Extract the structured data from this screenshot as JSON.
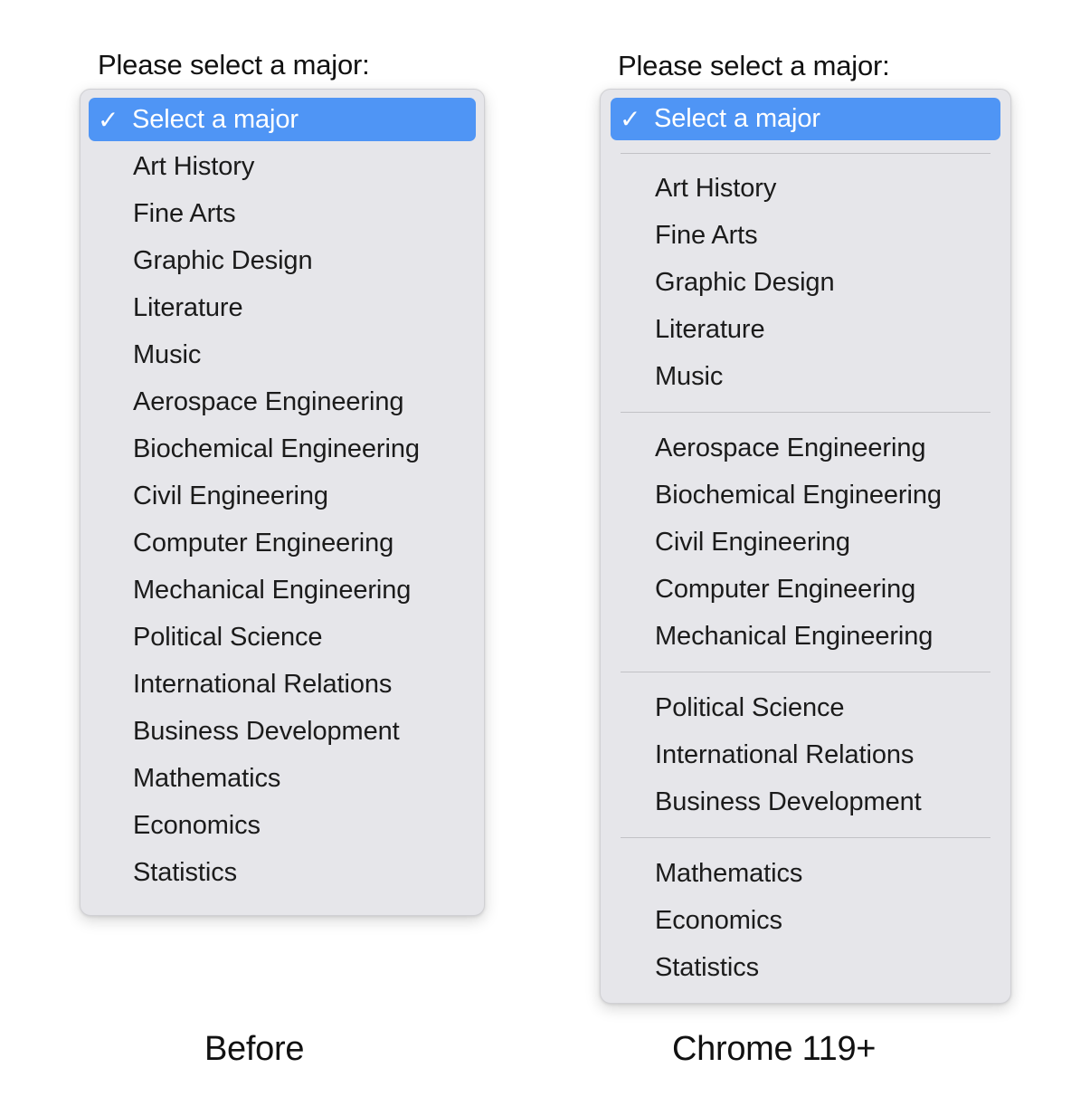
{
  "page": {
    "background_color": "#ffffff"
  },
  "colors": {
    "accent_blue": "#4f95f5",
    "panel_background": "#e6e6ea",
    "panel_border": "#d0d0d4",
    "separator": "#c2c2c6",
    "text": "#1b1b1b",
    "selected_text": "#ffffff"
  },
  "panels": {
    "before": {
      "prompt_label": "Please select a major:",
      "caption": "Before",
      "selected_option": {
        "check_glyph": "✓",
        "label": "Select a major"
      },
      "options": [
        "Art History",
        "Fine Arts",
        "Graphic Design",
        "Literature",
        "Music",
        "Aerospace Engineering",
        "Biochemical Engineering",
        "Civil Engineering",
        "Computer Engineering",
        "Mechanical Engineering",
        "Political Science",
        "International Relations",
        "Business Development",
        "Mathematics",
        "Economics",
        "Statistics"
      ]
    },
    "chrome119": {
      "prompt_label": "Please select a major:",
      "caption": "Chrome 119+",
      "selected_option": {
        "check_glyph": "✓",
        "label": "Select a major"
      },
      "groups": [
        {
          "options": [
            "Art History",
            "Fine Arts",
            "Graphic Design",
            "Literature",
            "Music"
          ]
        },
        {
          "options": [
            "Aerospace Engineering",
            "Biochemical Engineering",
            "Civil Engineering",
            "Computer Engineering",
            "Mechanical Engineering"
          ]
        },
        {
          "options": [
            "Political Science",
            "International Relations",
            "Business Development"
          ]
        },
        {
          "options": [
            "Mathematics",
            "Economics",
            "Statistics"
          ]
        }
      ]
    }
  }
}
